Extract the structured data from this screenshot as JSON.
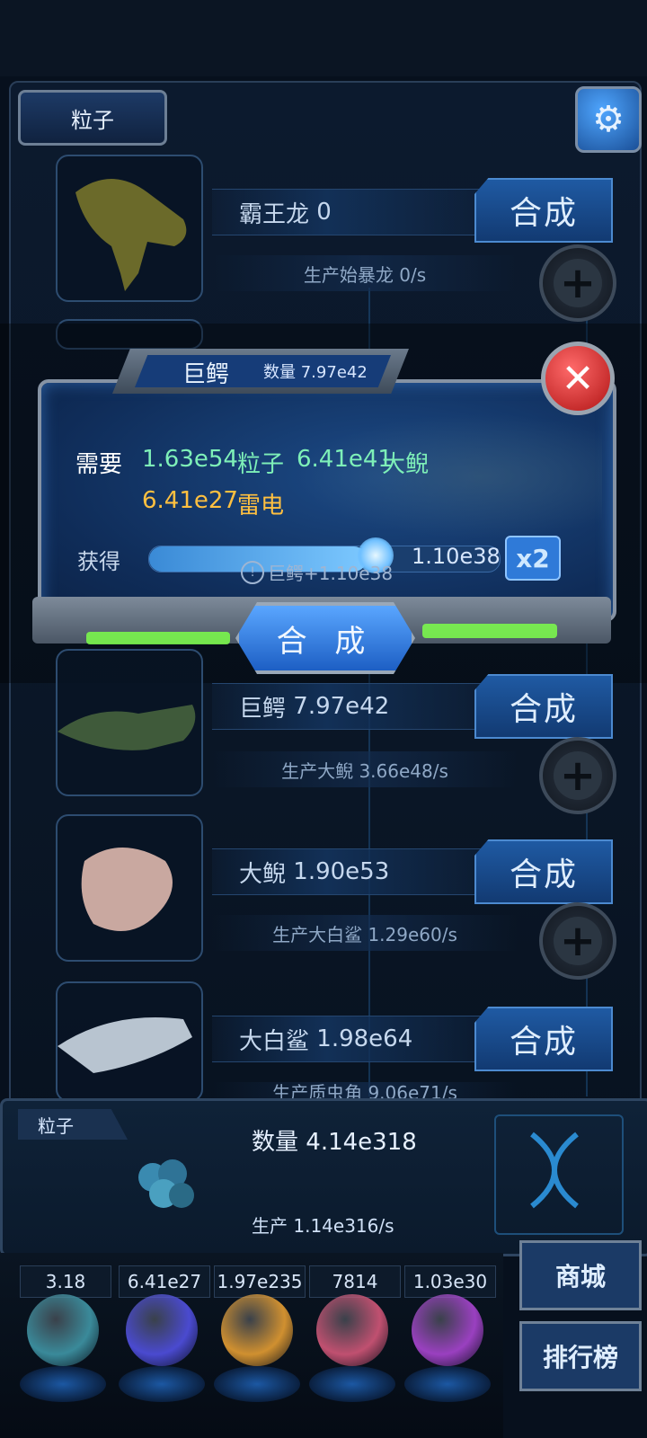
{
  "header": {
    "resource_tab": "粒子"
  },
  "rows": [
    {
      "name": "霸王龙",
      "count": "0",
      "production": "生产始暴龙 0/s",
      "action": "合成"
    },
    {
      "name": "巨鳄",
      "count": "7.97e42",
      "production": "生产大鲵 3.66e48/s",
      "action": "合成"
    },
    {
      "name": "大鲵",
      "count": "1.90e53",
      "production": "生产大白鲨 1.29e60/s",
      "action": "合成"
    },
    {
      "name": "大白鲨",
      "count": "1.98e64",
      "production": "生产质虫角 9.06e71/s",
      "action": "合成"
    }
  ],
  "dialog": {
    "title": "巨鳄",
    "quantity_label": "数量",
    "quantity": "7.97e42",
    "need_label": "需要",
    "requirements": [
      {
        "amount": "1.63e54",
        "item": "粒子"
      },
      {
        "amount": "6.41e41",
        "item": "大鲵"
      },
      {
        "amount": "6.41e27",
        "item": "雷电"
      }
    ],
    "get_label": "获得",
    "get_value": "1.10e38",
    "progress": 0.62,
    "multiplier": "x2",
    "tip": "巨鳄+1.10e38",
    "synth_button": "合 成"
  },
  "bottom": {
    "label": "粒子",
    "quantity_label": "数量",
    "quantity": "4.14e318",
    "production_label": "生产",
    "production": "1.14e316/s"
  },
  "resources": [
    {
      "value": "3.18",
      "color": "#3a8a9a"
    },
    {
      "value": "6.41e27",
      "color": "#4a4ad0"
    },
    {
      "value": "1.97e235",
      "color": "#d09030"
    },
    {
      "value": "7814",
      "color": "#c05070"
    },
    {
      "value": "1.03e30",
      "color": "#9a40c0"
    }
  ],
  "side_buttons": {
    "shop": "商城",
    "rank": "排行榜"
  },
  "icons": {
    "settings": "gear-icon",
    "close": "close-icon",
    "plus": "plus-icon",
    "info": "info-icon"
  }
}
